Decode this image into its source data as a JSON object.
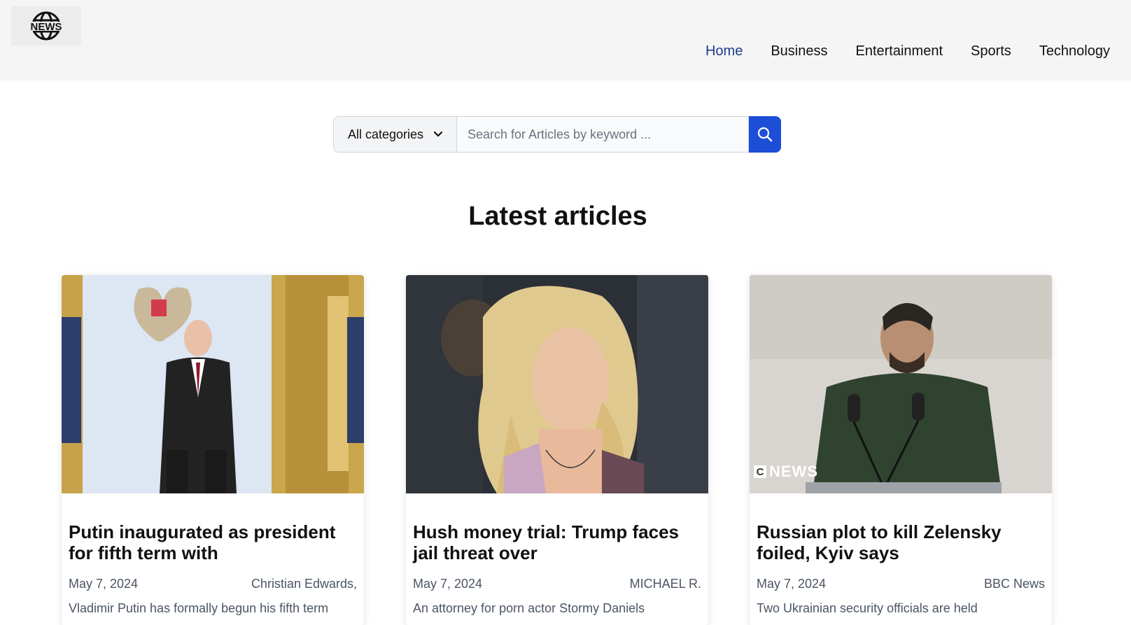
{
  "header": {
    "logo_text": "NEWS",
    "nav": [
      {
        "label": "Home",
        "active": true
      },
      {
        "label": "Business",
        "active": false
      },
      {
        "label": "Entertainment",
        "active": false
      },
      {
        "label": "Sports",
        "active": false
      },
      {
        "label": "Technology",
        "active": false
      }
    ]
  },
  "search": {
    "category_selected": "All categories",
    "placeholder": "Search for Articles by keyword ...",
    "icon": "search-icon"
  },
  "section_title": "Latest articles",
  "articles": [
    {
      "title": "Putin inaugurated as president for fifth term with",
      "date": "May 7, 2024",
      "author": "Christian Edwards,",
      "description": "Vladimir Putin has formally begun his fifth term"
    },
    {
      "title": "Hush money trial: Trump faces jail threat over",
      "date": "May 7, 2024",
      "author": "MICHAEL R.",
      "description": "An attorney for porn actor Stormy Daniels"
    },
    {
      "title": "Russian plot to kill Zelensky foiled, Kyiv says",
      "date": "May 7, 2024",
      "author": "BBC News",
      "description": "Two Ukrainian security officials are held"
    }
  ],
  "image_watermark": "NEWS",
  "image_watermark_letter": "C",
  "colors": {
    "accent": "#1d4ed8",
    "nav_active": "#1e3a8a",
    "header_bg": "#f5f5f5"
  }
}
